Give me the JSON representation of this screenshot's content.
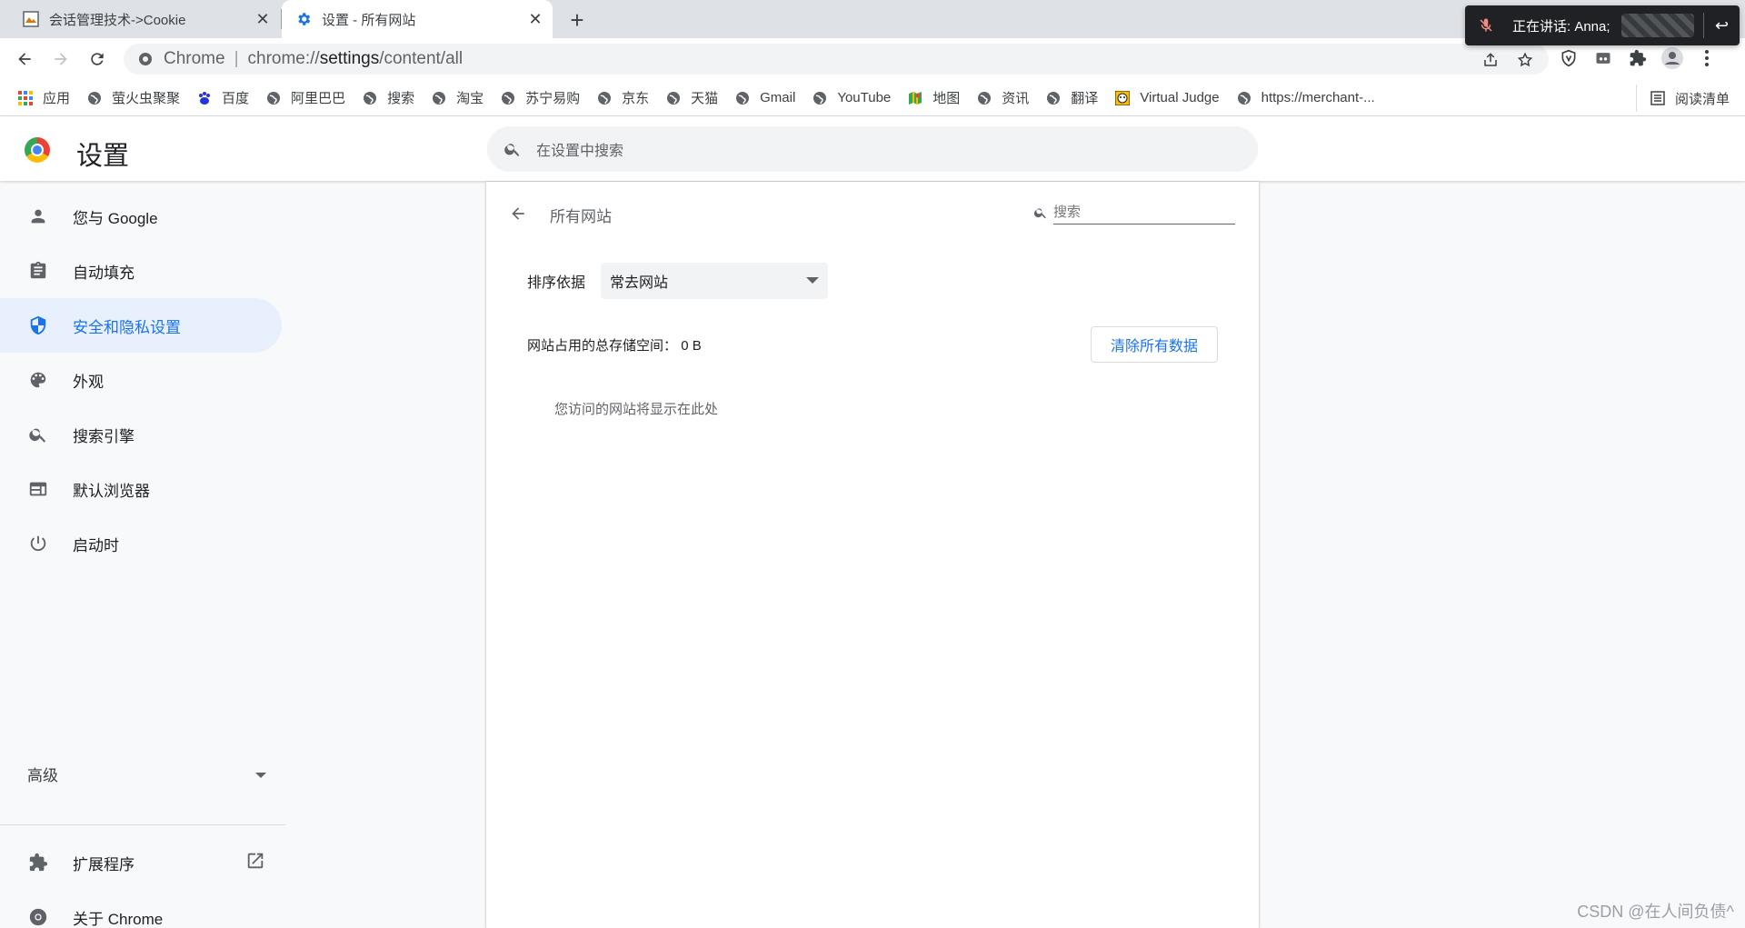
{
  "tabs": [
    {
      "title": "会话管理技术->Cookie",
      "icon": "article-favicon",
      "active": false
    },
    {
      "title": "设置 - 所有网站",
      "icon": "gear-icon",
      "active": true
    }
  ],
  "newtab_label": "+",
  "call_banner": {
    "text": "正在讲话: Anna;",
    "icon": "mic-muted-icon"
  },
  "omnibox": {
    "chip": "Chrome",
    "url_scheme": "chrome://",
    "url_host": "settings",
    "url_path": "/content/all"
  },
  "bookmarks": [
    {
      "label": "应用",
      "icon": "apps-grid-icon"
    },
    {
      "label": "萤火虫聚聚",
      "icon": "globe-icon"
    },
    {
      "label": "百度",
      "icon": "baidu-paw-icon"
    },
    {
      "label": "阿里巴巴",
      "icon": "globe-icon"
    },
    {
      "label": "搜索",
      "icon": "globe-icon"
    },
    {
      "label": "淘宝",
      "icon": "globe-icon"
    },
    {
      "label": "苏宁易购",
      "icon": "globe-icon"
    },
    {
      "label": "京东",
      "icon": "globe-icon"
    },
    {
      "label": "天猫",
      "icon": "globe-icon"
    },
    {
      "label": "Gmail",
      "icon": "globe-icon"
    },
    {
      "label": "YouTube",
      "icon": "globe-icon"
    },
    {
      "label": "地图",
      "icon": "maps-icon"
    },
    {
      "label": "资讯",
      "icon": "globe-icon"
    },
    {
      "label": "翻译",
      "icon": "globe-icon"
    },
    {
      "label": "Virtual Judge",
      "icon": "vjudge-icon"
    },
    {
      "label": "https://merchant-...",
      "icon": "globe-icon"
    }
  ],
  "reading_list": "阅读清单",
  "settings": {
    "title": "设置",
    "search_placeholder": "在设置中搜索"
  },
  "sidebar": {
    "items": [
      {
        "label": "您与 Google",
        "icon": "person-icon",
        "selected": false
      },
      {
        "label": "自动填充",
        "icon": "clipboard-icon",
        "selected": false
      },
      {
        "label": "安全和隐私设置",
        "icon": "shield-icon",
        "selected": true
      },
      {
        "label": "外观",
        "icon": "palette-icon",
        "selected": false
      },
      {
        "label": "搜索引擎",
        "icon": "search-icon",
        "selected": false
      },
      {
        "label": "默认浏览器",
        "icon": "browser-window-icon",
        "selected": false
      },
      {
        "label": "启动时",
        "icon": "power-icon",
        "selected": false
      }
    ],
    "advanced": "高级",
    "extensions": "扩展程序",
    "about": "关于 Chrome"
  },
  "main": {
    "title": "所有网站",
    "search_placeholder": "搜索",
    "sort_label": "排序依据",
    "sort_value": "常去网站",
    "storage_label": "网站占用的总存储空间：",
    "storage_value": "0 B",
    "clear_button": "清除所有数据",
    "empty_message": "您访问的网站将显示在此处"
  },
  "watermark": "CSDN @在人间负债^",
  "colors": {
    "accent": "#1a73e8",
    "selected_bg": "#e8f0fe",
    "tabstrip": "#dee1e6"
  }
}
